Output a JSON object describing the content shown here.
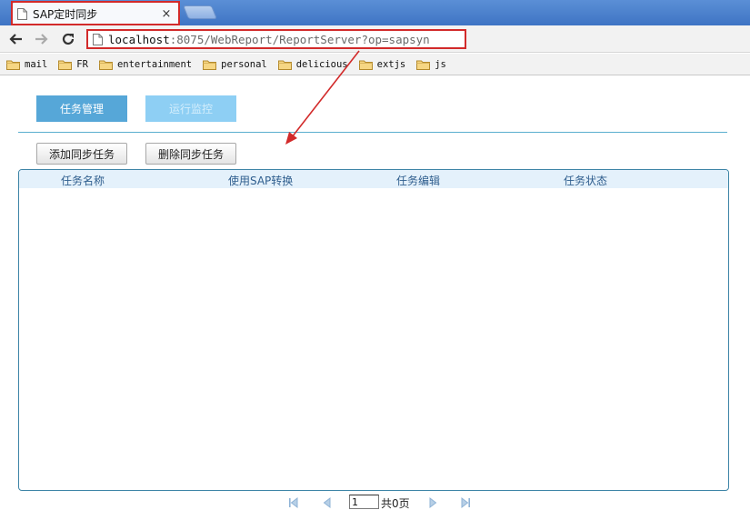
{
  "browser": {
    "tab": {
      "title": "SAP定时同步",
      "close_glyph": "×"
    },
    "address": {
      "host": "localhost",
      "path": ":8075/WebReport/ReportServer?op=sapsyn"
    },
    "bookmarks": [
      {
        "label": "mail"
      },
      {
        "label": "FR"
      },
      {
        "label": "entertainment"
      },
      {
        "label": "personal"
      },
      {
        "label": "delicious"
      },
      {
        "label": "extjs"
      },
      {
        "label": "js"
      }
    ],
    "icons": {
      "back": "back-arrow-icon",
      "forward": "forward-arrow-icon",
      "reload": "reload-icon",
      "page": "page-icon",
      "folder": "folder-icon"
    }
  },
  "page": {
    "top_tabs": {
      "task_manage": "任务管理",
      "monitor": "运行监控"
    },
    "actions": {
      "add": "添加同步任务",
      "delete": "删除同步任务"
    },
    "grid": {
      "columns": [
        "任务名称",
        "使用SAP转换",
        "任务编辑",
        "任务状态"
      ],
      "rows": []
    },
    "pager": {
      "page_value": "1",
      "total_text": "共0页"
    }
  },
  "colors": {
    "tab_bar": "#3e74c4",
    "primary_button": "#56a7d8",
    "inactive_button": "#8ecff4",
    "grid_border": "#3d84a6",
    "grid_header": "#e4f1fb",
    "annotation_red": "#d22a2a"
  }
}
